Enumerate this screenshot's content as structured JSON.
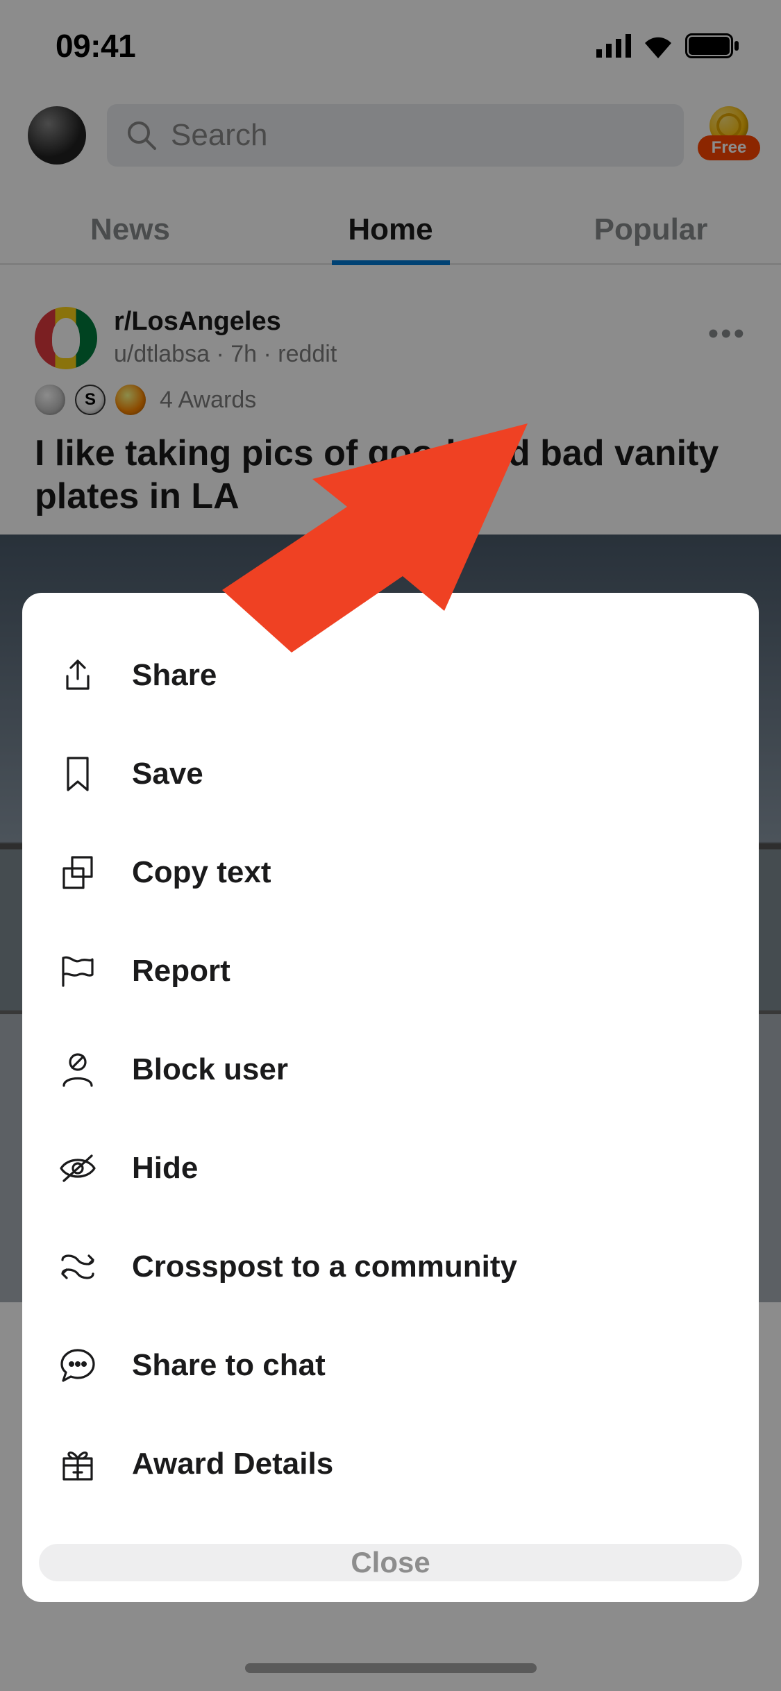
{
  "status": {
    "time": "09:41"
  },
  "header": {
    "search_placeholder": "Search",
    "coins_badge": "Free"
  },
  "tabs": {
    "news": "News",
    "home": "Home",
    "popular": "Popular",
    "active": "home"
  },
  "post": {
    "subreddit": "r/LosAngeles",
    "author": "u/dtlabsa",
    "age": "7h",
    "source": "reddit",
    "byline": "u/dtlabsa · 7h · reddit",
    "awards_count": "4 Awards",
    "title": "I like taking pics of good and bad vanity plates in LA"
  },
  "sheet": {
    "items": [
      {
        "icon": "share-icon",
        "label": "Share"
      },
      {
        "icon": "bookmark-icon",
        "label": "Save"
      },
      {
        "icon": "copy-icon",
        "label": "Copy text"
      },
      {
        "icon": "flag-icon",
        "label": "Report"
      },
      {
        "icon": "block-user-icon",
        "label": "Block user"
      },
      {
        "icon": "hide-icon",
        "label": "Hide"
      },
      {
        "icon": "crosspost-icon",
        "label": "Crosspost to a community"
      },
      {
        "icon": "chat-icon",
        "label": "Share to chat"
      },
      {
        "icon": "gift-icon",
        "label": "Award Details"
      }
    ],
    "close": "Close"
  }
}
